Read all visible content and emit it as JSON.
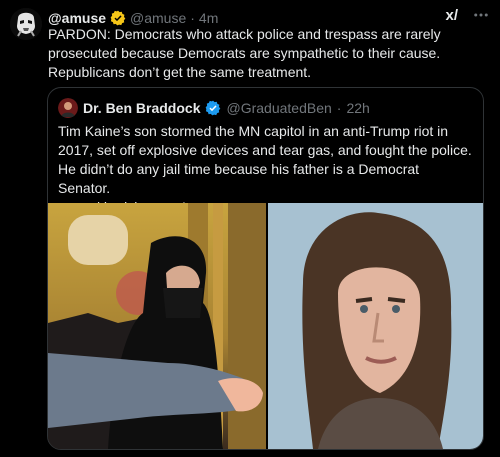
{
  "post": {
    "author_name": "@amuse",
    "author_handle": "@amuse",
    "separator": "·",
    "time": "4m",
    "text": "PARDON: Democrats who attack police and trespass are rarely prosecuted because Democrats are sympathetic to their cause. Republicans don’t get the same treatment.",
    "grok_label": "x/"
  },
  "quote": {
    "author_name": "Dr. Ben Braddock",
    "author_handle": "@GraduatedBen",
    "separator": "·",
    "time": "22h",
    "text": "Tim Kaine’s son stormed the MN capitol in an anti-Trump riot in 2017, set off explosive devices and tear gas, and fought the police. He didn’t do any jail time because his father is a Democrat Senator.",
    "link": "x.com/derrickevans4w..."
  },
  "colors": {
    "background": "#000000",
    "text": "#e7e9ea",
    "muted": "#71767b",
    "verified": "#1d9bf0",
    "border": "#2f3336"
  },
  "icons": {
    "verified": "verified-badge",
    "menu": "more-horizontal"
  }
}
